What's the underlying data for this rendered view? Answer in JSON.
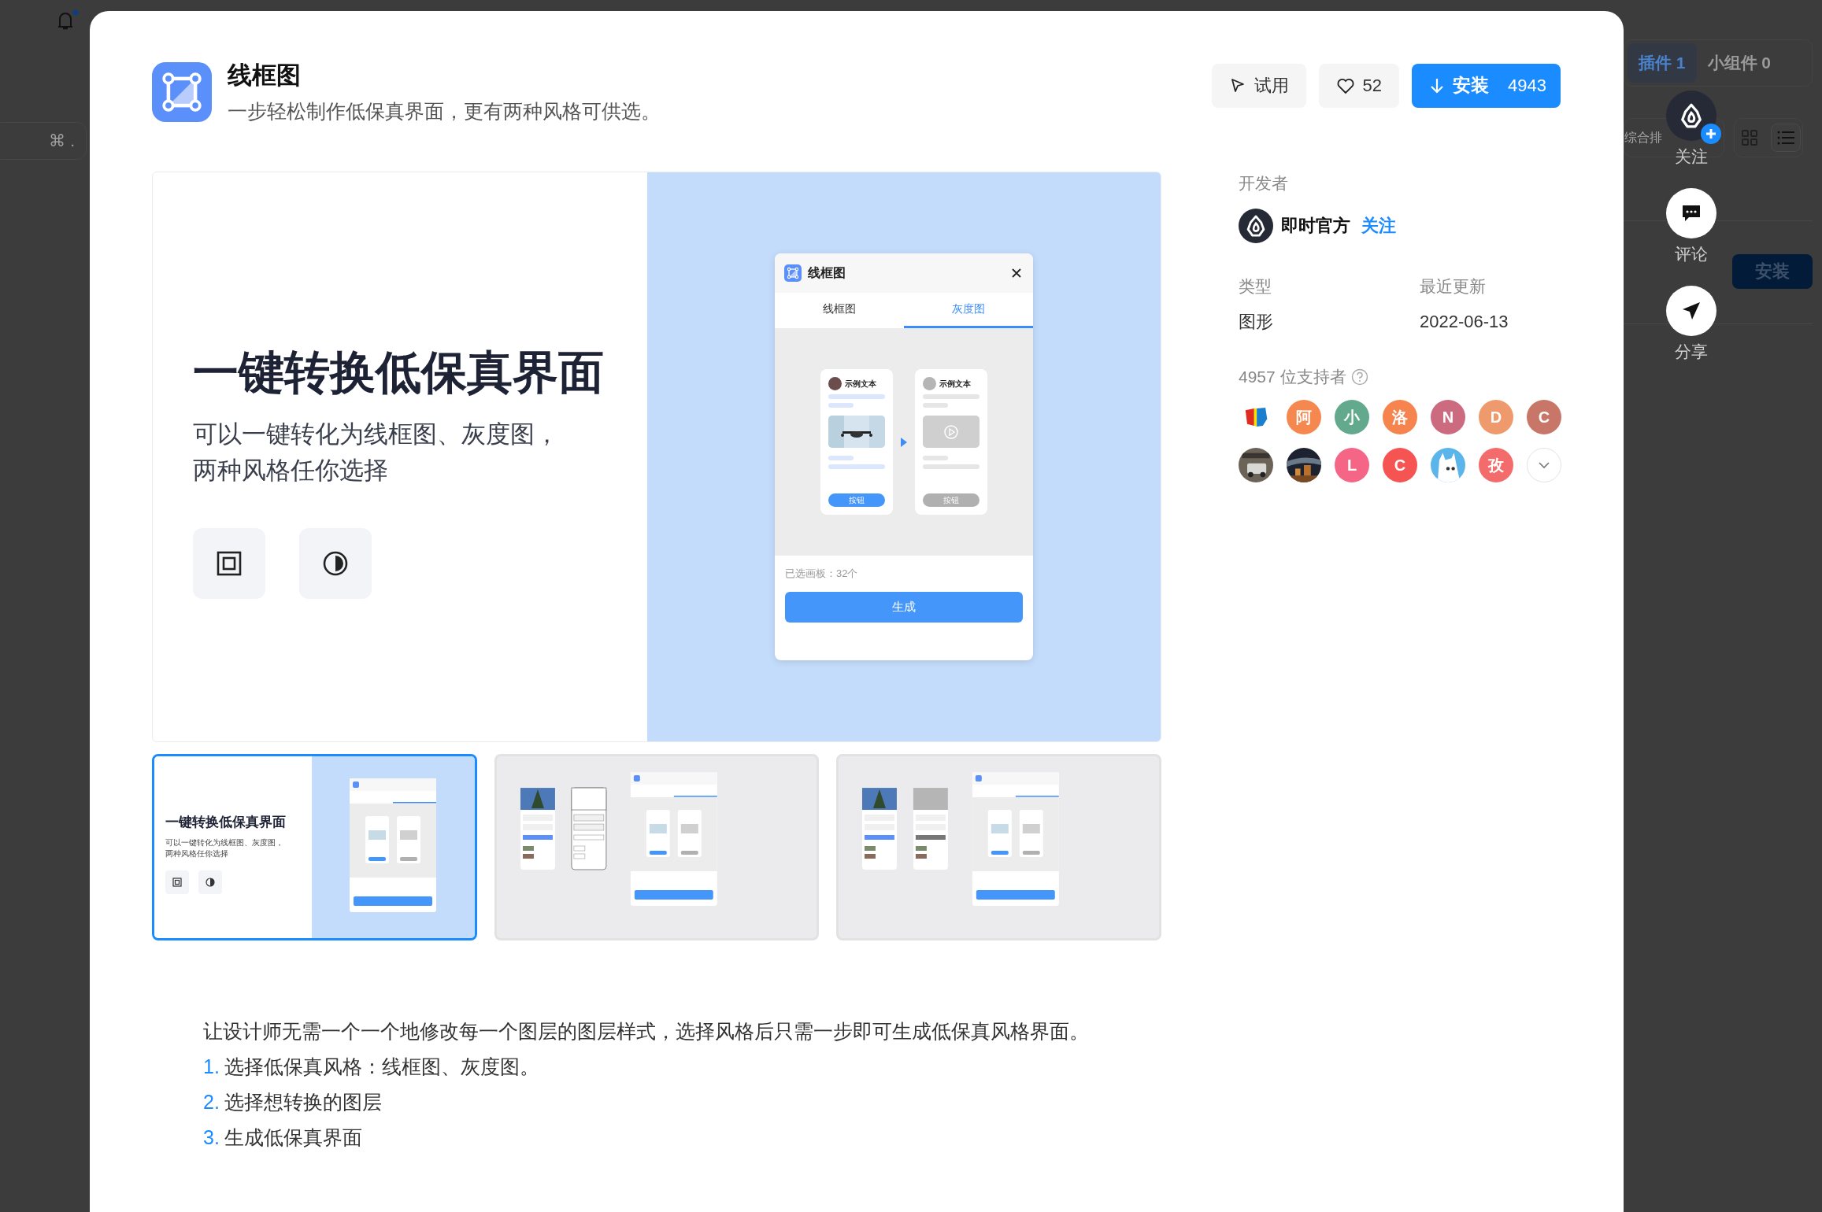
{
  "background_page": {
    "shortcut_hint": "⌘ .",
    "tabs": [
      {
        "label": "插件 1",
        "selected": true
      },
      {
        "label": "小组件 0",
        "selected": false
      }
    ],
    "sort": "综合排",
    "install_button": "安装"
  },
  "floating_actions": [
    {
      "kind": "follow",
      "label": "关注"
    },
    {
      "kind": "comment",
      "label": "评论"
    },
    {
      "kind": "share",
      "label": "分享"
    }
  ],
  "plugin": {
    "title": "线框图",
    "subtitle": "一步轻松制作低保真界面，更有两种风格可供选。",
    "try_button": "试用",
    "likes": "52",
    "install_button": {
      "label": "安装",
      "count": "4943"
    }
  },
  "preview": {
    "heading": "一键转换低保真界面",
    "lines": [
      "可以一键转化为线框图、灰度图，",
      "两种风格任你选择"
    ],
    "dialog": {
      "title": "线框图",
      "tabs": [
        {
          "label": "线框图",
          "selected": false
        },
        {
          "label": "灰度图",
          "selected": true
        }
      ],
      "cards": [
        {
          "kind": "color",
          "caption": "示例文本",
          "button": "按钮"
        },
        {
          "kind": "gray",
          "caption": "示例文本",
          "button": "按钮"
        }
      ],
      "selected_count": "已选画板：32个",
      "generate_button": "生成"
    }
  },
  "thumbnails": [
    {
      "kind": "intro",
      "selected": true,
      "heading": "一键转换低保真界面",
      "lines": [
        "可以一键转化为线框图、灰度图，",
        "两种风格任你选择"
      ]
    },
    {
      "kind": "wireframe",
      "selected": false
    },
    {
      "kind": "grayscale",
      "selected": false
    }
  ],
  "description": {
    "intro": "让设计师无需一个一个地修改每一个图层的图层样式，选择风格后只需一步即可生成低保真风格界面。",
    "steps": [
      {
        "number": "1.",
        "text": "选择低保真风格：线框图、灰度图。"
      },
      {
        "number": "2.",
        "text": "选择想转换的图层"
      },
      {
        "number": "3.",
        "text": "生成低保真界面"
      }
    ]
  },
  "info": {
    "developer_label": "开发者",
    "developer": "即时官方",
    "follow_link": "关注",
    "type_label": "类型",
    "type": "图形",
    "updated_label": "最近更新",
    "updated": "2022-06-13",
    "supporters_label": "4957 位支持者",
    "supporters": [
      {
        "kind": "picture"
      },
      {
        "kind": "letter",
        "text": "阿",
        "color": "#f5884f"
      },
      {
        "kind": "letter",
        "text": "小",
        "color": "#62a98d"
      },
      {
        "kind": "letter",
        "text": "洛",
        "color": "#f5844f"
      },
      {
        "kind": "letter",
        "text": "N",
        "color": "#cc6a80"
      },
      {
        "kind": "letter",
        "text": "D",
        "color": "#ee9a6c"
      },
      {
        "kind": "letter",
        "text": "C",
        "color": "#c87668"
      },
      {
        "kind": "picture"
      },
      {
        "kind": "picture"
      },
      {
        "kind": "letter",
        "text": "L",
        "color": "#f56585"
      },
      {
        "kind": "letter",
        "text": "C",
        "color": "#f55453"
      },
      {
        "kind": "picture"
      },
      {
        "kind": "letter",
        "text": "孜",
        "color": "#f46b6b"
      }
    ]
  }
}
